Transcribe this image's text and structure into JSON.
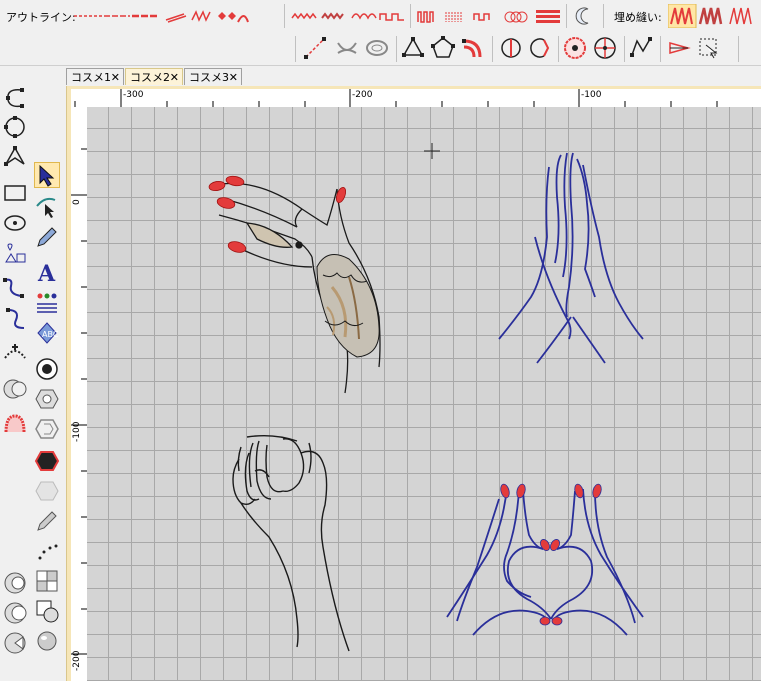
{
  "toolbar_outline": {
    "label": "アウトライン:"
  },
  "toolbar_fill": {
    "label": "埋め縫い:"
  },
  "tabs": [
    {
      "label": "コスメ1",
      "close": "✕"
    },
    {
      "label": "コスメ2",
      "close": "✕"
    },
    {
      "label": "コスメ3",
      "close": "✕"
    }
  ],
  "active_tab": "コスメ2",
  "ruler": {
    "h_ticks": [
      "-300",
      "-200",
      "-100"
    ],
    "v_ticks": [
      "0",
      "-100",
      "-200"
    ]
  },
  "colors": {
    "accent_red": "#e33b3b",
    "thread_black": "#1a1a1a",
    "thread_blue": "#2a2f9a",
    "lace_tan": "#b89a72"
  },
  "designs": [
    {
      "name": "hand-with-lace",
      "thread": "black"
    },
    {
      "name": "praying-hands",
      "thread": "blue"
    },
    {
      "name": "clasped-hands",
      "thread": "black"
    },
    {
      "name": "heart-hands",
      "thread": "blue"
    }
  ]
}
